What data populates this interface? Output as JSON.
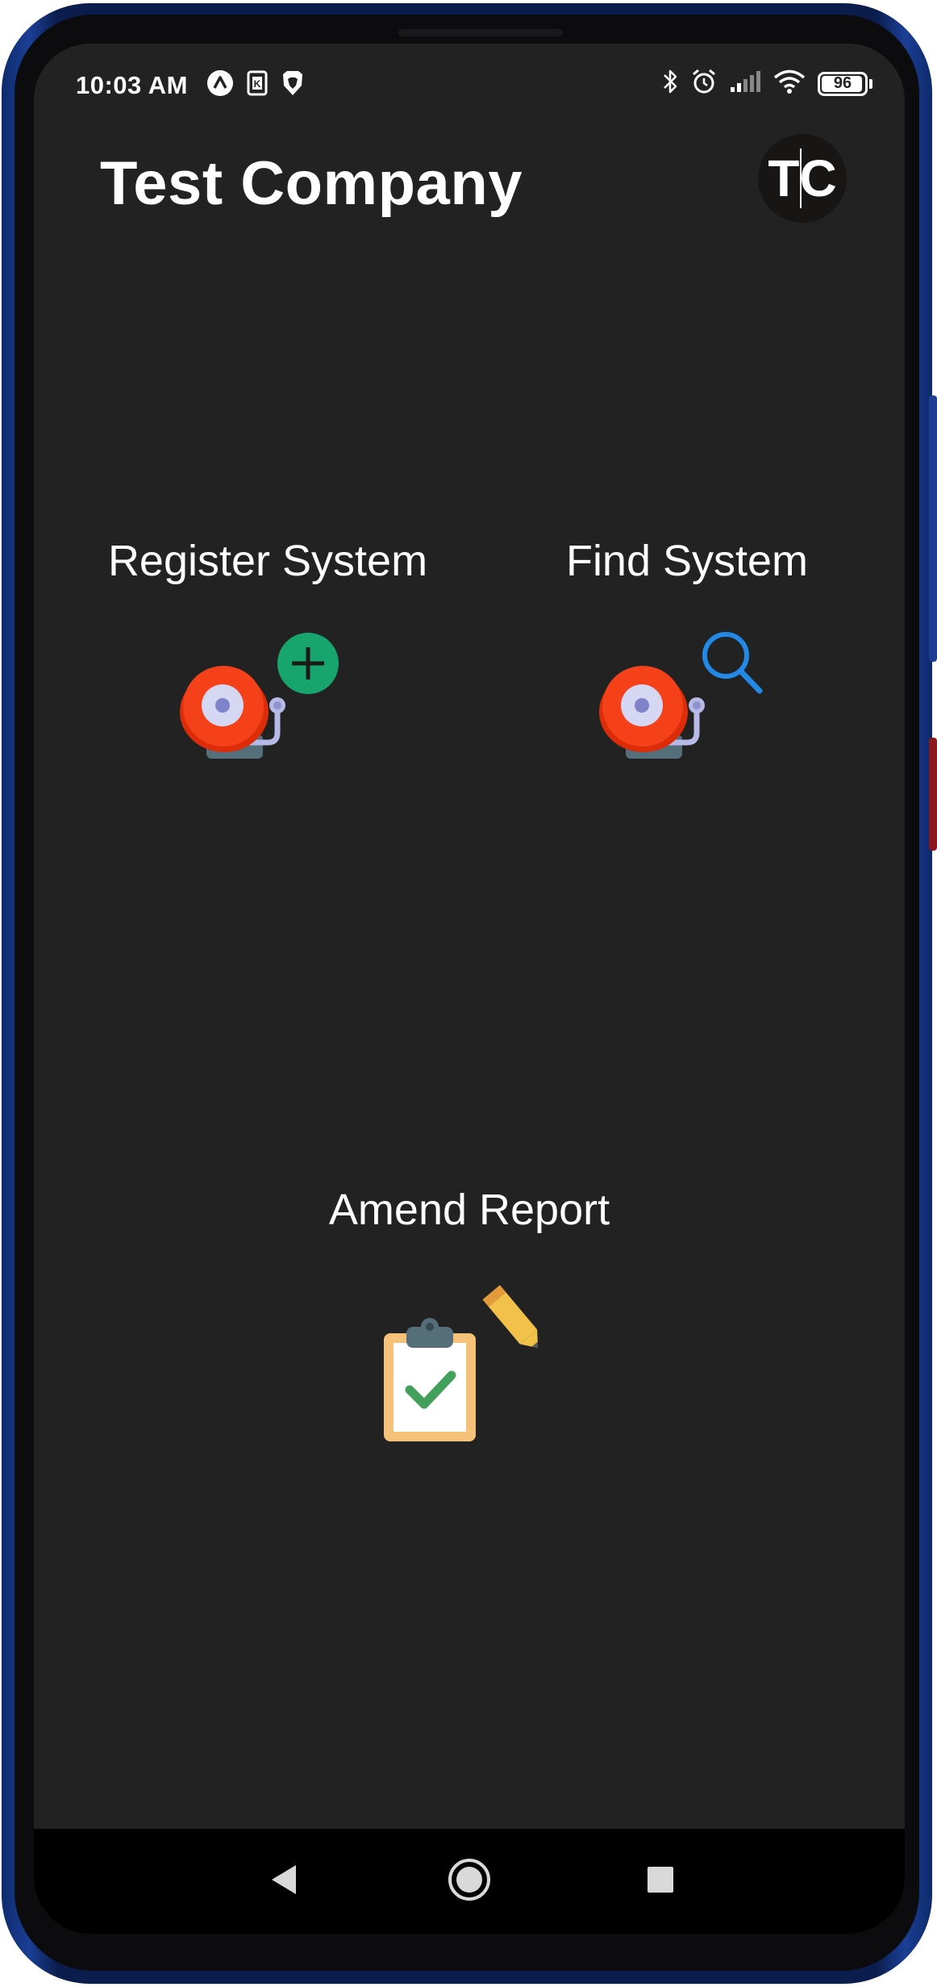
{
  "status_bar": {
    "time": "10:03 AM",
    "battery_level": "96",
    "battery_fraction": 0.96,
    "left_icons": [
      "arrow-up-circle-icon",
      "k-square-icon",
      "lion-shield-icon"
    ],
    "right_icons": [
      "bluetooth-icon",
      "alarm-icon",
      "signal-icon",
      "wifi-icon",
      "battery-icon"
    ]
  },
  "app_bar": {
    "title": "Test Company",
    "avatar_initials": "TC"
  },
  "tiles": {
    "register": {
      "label": "Register System",
      "icon": "alarm-bell-add-icon",
      "badge_color": "#16a06a"
    },
    "find": {
      "label": "Find System",
      "icon": "alarm-bell-search-icon",
      "badge_color": "#2289e6"
    },
    "amend": {
      "label": "Amend Report",
      "icon": "clipboard-check-edit-icon",
      "badge_color": "#f2c14a"
    }
  },
  "colors": {
    "background": "#222222",
    "bell_red": "#f23a10",
    "nav_bar": "#000000"
  },
  "nav": {
    "buttons": [
      "back-icon",
      "home-icon",
      "recents-icon"
    ]
  }
}
